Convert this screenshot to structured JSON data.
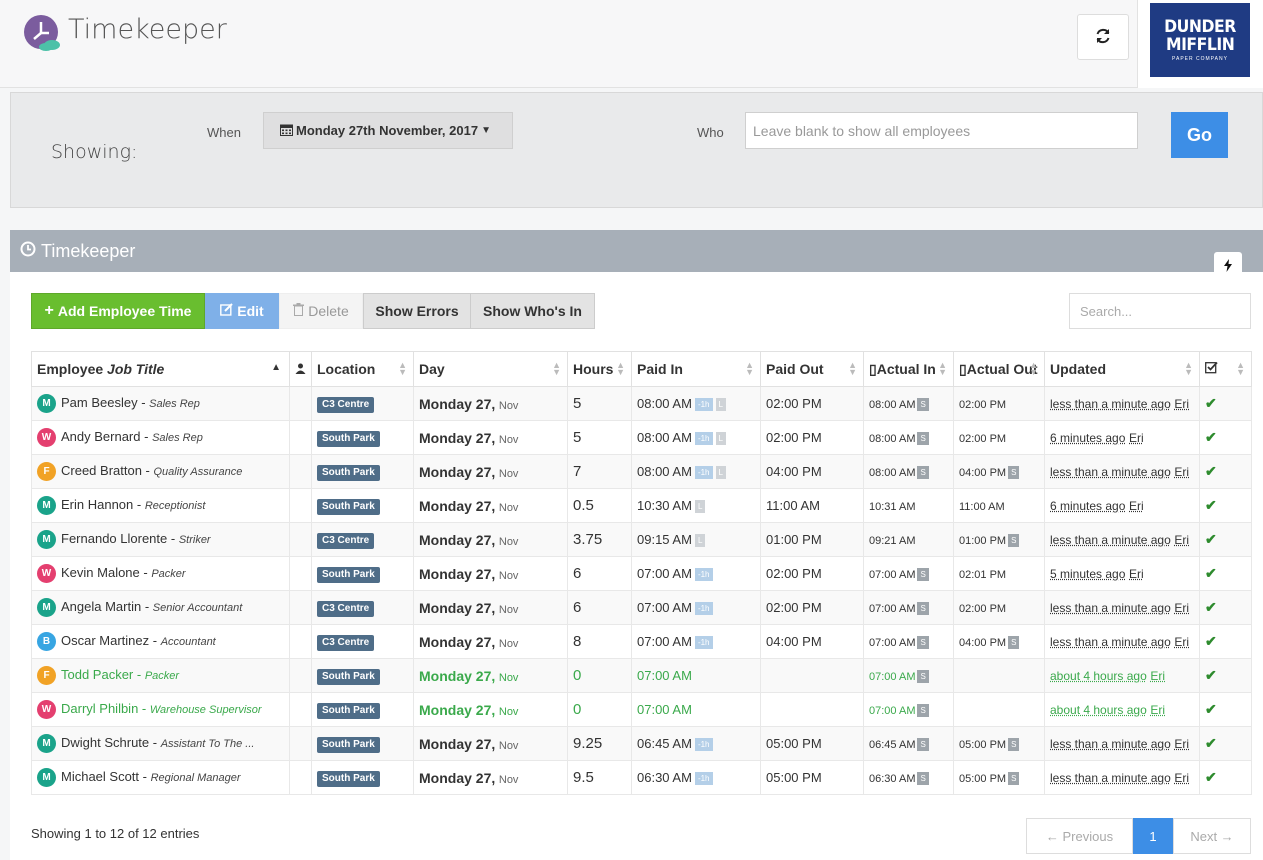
{
  "app": {
    "title": "Timekeeper"
  },
  "brand": {
    "line1": "DUNDER",
    "line2": "MIFFLIN",
    "line3": "PAPER COMPANY"
  },
  "filter": {
    "showing_label": "Showing:",
    "when_label": "When",
    "date_value": "Monday 27th November, 2017",
    "who_label": "Who",
    "who_placeholder": "Leave blank to show all employees",
    "go_label": "Go"
  },
  "panel": {
    "title": "Timekeeper"
  },
  "toolbar": {
    "add_label": "Add Employee Time",
    "edit_label": "Edit",
    "delete_label": "Delete",
    "errors_label": "Show Errors",
    "whos_in_label": "Show Who's In",
    "search_placeholder": "Search..."
  },
  "table": {
    "headers": {
      "employee": "Employee",
      "job_title": "Job Title",
      "location": "Location",
      "day": "Day",
      "hours": "Hours",
      "paid_in": "Paid In",
      "paid_out": "Paid Out",
      "actual_in": "Actual In",
      "actual_out": "Actual Out",
      "updated": "Updated"
    },
    "rows": [
      {
        "initial": "M",
        "name": "Pam Beesley",
        "title": "Sales Rep",
        "location": "C3 Centre",
        "day": "Monday 27,",
        "mon": "Nov",
        "hours": "5",
        "paid_in": "08:00 AM",
        "tags": [
          "-1h",
          "L"
        ],
        "paid_out": "02:00 PM",
        "actual_in": "08:00 AM",
        "ai_s": true,
        "actual_out": "02:00 PM",
        "ao_s": false,
        "updated": "less than a minute ago",
        "by": "Eri",
        "green": false
      },
      {
        "initial": "W",
        "name": "Andy Bernard",
        "title": "Sales Rep",
        "location": "South Park",
        "day": "Monday 27,",
        "mon": "Nov",
        "hours": "5",
        "paid_in": "08:00 AM",
        "tags": [
          "-1h",
          "L"
        ],
        "paid_out": "02:00 PM",
        "actual_in": "08:00 AM",
        "ai_s": true,
        "actual_out": "02:00 PM",
        "ao_s": false,
        "updated": "6 minutes ago",
        "by": "Eri",
        "green": false
      },
      {
        "initial": "F",
        "name": "Creed Bratton",
        "title": "Quality Assurance",
        "location": "South Park",
        "day": "Monday 27,",
        "mon": "Nov",
        "hours": "7",
        "paid_in": "08:00 AM",
        "tags": [
          "-1h",
          "L"
        ],
        "paid_out": "04:00 PM",
        "actual_in": "08:00 AM",
        "ai_s": true,
        "actual_out": "04:00 PM",
        "ao_s": true,
        "updated": "less than a minute ago",
        "by": "Eri",
        "green": false
      },
      {
        "initial": "M",
        "name": "Erin Hannon",
        "title": "Receptionist",
        "location": "South Park",
        "day": "Monday 27,",
        "mon": "Nov",
        "hours": "0.5",
        "paid_in": "10:30 AM",
        "tags": [
          "L"
        ],
        "paid_out": "11:00 AM",
        "actual_in": "10:31 AM",
        "ai_s": false,
        "actual_out": "11:00 AM",
        "ao_s": false,
        "updated": "6 minutes ago",
        "by": "Eri",
        "green": false
      },
      {
        "initial": "M",
        "name": "Fernando Llorente",
        "title": "Striker",
        "location": "C3 Centre",
        "day": "Monday 27,",
        "mon": "Nov",
        "hours": "3.75",
        "paid_in": "09:15 AM",
        "tags": [
          "L"
        ],
        "paid_out": "01:00 PM",
        "actual_in": "09:21 AM",
        "ai_s": false,
        "actual_out": "01:00 PM",
        "ao_s": true,
        "updated": "less than a minute ago",
        "by": "Eri",
        "green": false
      },
      {
        "initial": "W",
        "name": "Kevin Malone",
        "title": "Packer",
        "location": "South Park",
        "day": "Monday 27,",
        "mon": "Nov",
        "hours": "6",
        "paid_in": "07:00 AM",
        "tags": [
          "-1h"
        ],
        "paid_out": "02:00 PM",
        "actual_in": "07:00 AM",
        "ai_s": true,
        "actual_out": "02:01 PM",
        "ao_s": false,
        "updated": "5 minutes ago",
        "by": "Eri",
        "green": false
      },
      {
        "initial": "M",
        "name": "Angela Martin",
        "title": "Senior Accountant",
        "location": "C3 Centre",
        "day": "Monday 27,",
        "mon": "Nov",
        "hours": "6",
        "paid_in": "07:00 AM",
        "tags": [
          "-1h"
        ],
        "paid_out": "02:00 PM",
        "actual_in": "07:00 AM",
        "ai_s": true,
        "actual_out": "02:00 PM",
        "ao_s": false,
        "updated": "less than a minute ago",
        "by": "Eri",
        "green": false
      },
      {
        "initial": "B",
        "name": "Oscar Martinez",
        "title": "Accountant",
        "location": "C3 Centre",
        "day": "Monday 27,",
        "mon": "Nov",
        "hours": "8",
        "paid_in": "07:00 AM",
        "tags": [
          "-1h"
        ],
        "paid_out": "04:00 PM",
        "actual_in": "07:00 AM",
        "ai_s": true,
        "actual_out": "04:00 PM",
        "ao_s": true,
        "updated": "less than a minute ago",
        "by": "Eri",
        "green": false
      },
      {
        "initial": "F",
        "name": "Todd Packer",
        "title": "Packer",
        "location": "South Park",
        "day": "Monday 27,",
        "mon": "Nov",
        "hours": "0",
        "paid_in": "07:00 AM",
        "tags": [],
        "paid_out": "",
        "actual_in": "07:00 AM",
        "ai_s": true,
        "actual_out": "",
        "ao_s": false,
        "updated": "about 4 hours ago",
        "by": "Eri",
        "green": true
      },
      {
        "initial": "W",
        "name": "Darryl Philbin",
        "title": "Warehouse Supervisor",
        "location": "South Park",
        "day": "Monday 27,",
        "mon": "Nov",
        "hours": "0",
        "paid_in": "07:00 AM",
        "tags": [],
        "paid_out": "",
        "actual_in": "07:00 AM",
        "ai_s": true,
        "actual_out": "",
        "ao_s": false,
        "updated": "about 4 hours ago",
        "by": "Eri",
        "green": true
      },
      {
        "initial": "M",
        "name": "Dwight Schrute",
        "title": "Assistant To The ...",
        "location": "South Park",
        "day": "Monday 27,",
        "mon": "Nov",
        "hours": "9.25",
        "paid_in": "06:45 AM",
        "tags": [
          "-1h"
        ],
        "paid_out": "05:00 PM",
        "actual_in": "06:45 AM",
        "ai_s": true,
        "actual_out": "05:00 PM",
        "ao_s": true,
        "updated": "less than a minute ago",
        "by": "Eri",
        "green": false
      },
      {
        "initial": "M",
        "name": "Michael Scott",
        "title": "Regional Manager",
        "location": "South Park",
        "day": "Monday 27,",
        "mon": "Nov",
        "hours": "9.5",
        "paid_in": "06:30 AM",
        "tags": [
          "-1h"
        ],
        "paid_out": "05:00 PM",
        "actual_in": "06:30 AM",
        "ai_s": true,
        "actual_out": "05:00 PM",
        "ao_s": true,
        "updated": "less than a minute ago",
        "by": "Eri",
        "green": false
      }
    ],
    "s_tag": "S"
  },
  "footer": {
    "info": "Showing 1 to 12 of 12 entries",
    "prev": "← Previous",
    "page": "1",
    "next": "Next →"
  },
  "colors": {
    "accent": "#3d8ee6",
    "add": "#69be2f",
    "active_row": "#3aa94b",
    "panel_header": "#a7afb8",
    "location_badge": "#4f6d88"
  }
}
